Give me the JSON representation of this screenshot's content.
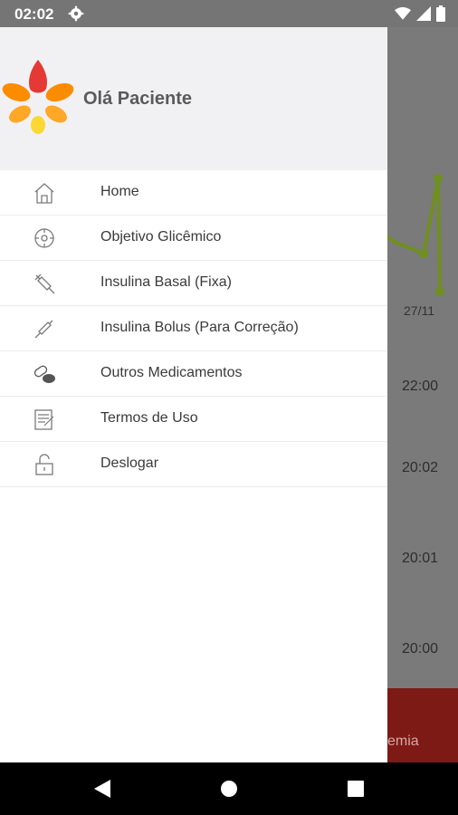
{
  "status_bar": {
    "time": "02:02",
    "icons": [
      "gear-icon",
      "wifi-icon",
      "signal-icon",
      "battery-icon"
    ]
  },
  "drawer": {
    "greeting": "Olá Paciente",
    "menu": [
      {
        "label": "Home",
        "icon": "home-icon"
      },
      {
        "label": "Objetivo Glicêmico",
        "icon": "target-icon"
      },
      {
        "label": "Insulina Basal (Fixa)",
        "icon": "syringe-icon"
      },
      {
        "label": "Insulina Bolus (Para Correção)",
        "icon": "pen-syringe-icon"
      },
      {
        "label": "Outros Medicamentos",
        "icon": "pills-icon"
      },
      {
        "label": "Termos de Uso",
        "icon": "document-icon"
      },
      {
        "label": "Deslogar",
        "icon": "unlock-icon"
      }
    ]
  },
  "background": {
    "date": "27/11",
    "times": [
      "22:00",
      "20:02",
      "20:01",
      "20:00"
    ],
    "footer_text": "emia",
    "accent_color": "#8bc34a"
  },
  "colors": {
    "logo_red": "#e53935",
    "logo_orange": "#fb8c00",
    "logo_yellow": "#fdd835",
    "footer_red": "#c62828"
  }
}
